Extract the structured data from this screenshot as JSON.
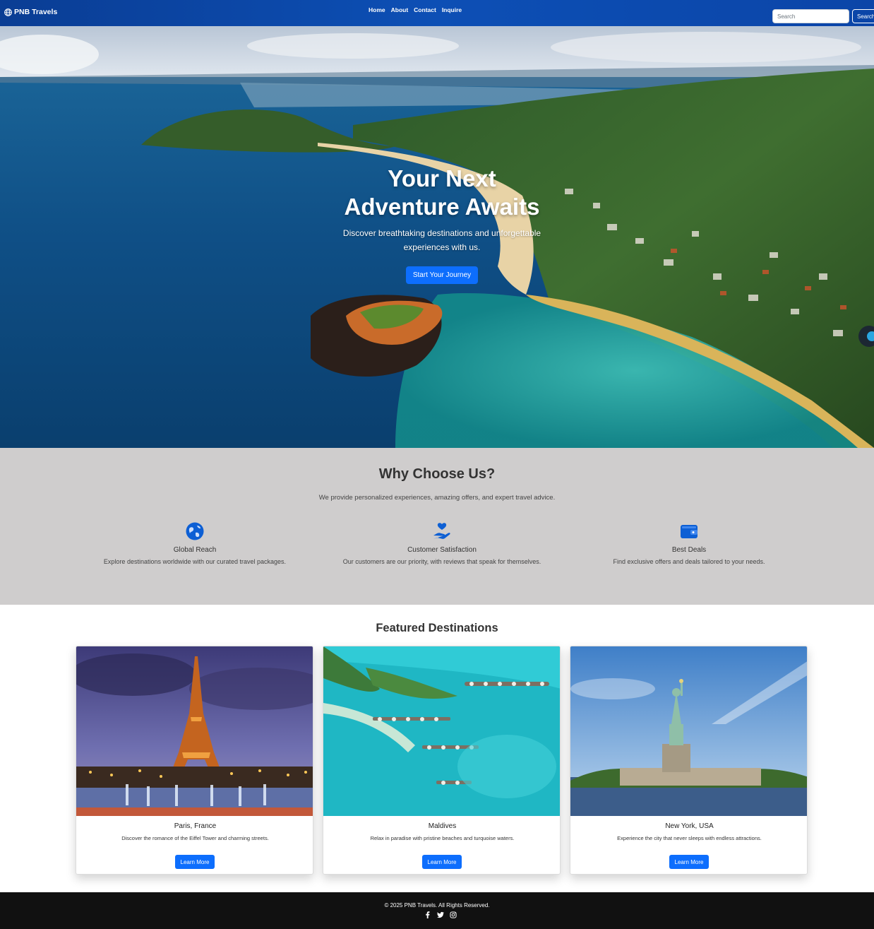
{
  "navbar": {
    "brand": "PNB Travels",
    "brand_icon": "globe-icon",
    "links": [
      "Home",
      "About",
      "Contact",
      "Inquire"
    ],
    "search_placeholder": "Search",
    "search_button": "Search"
  },
  "hero": {
    "title": "Your Next Adventure Awaits",
    "subtitle": "Discover breathtaking destinations and unforgettable experiences with us.",
    "cta": "Start Your Journey"
  },
  "why": {
    "title": "Why Choose Us?",
    "subtitle": "We provide personalized experiences, amazing offers, and expert travel advice.",
    "features": [
      {
        "icon": "globe-icon",
        "title": "Global Reach",
        "text": "Explore destinations worldwide with our curated travel packages."
      },
      {
        "icon": "hand-heart-icon",
        "title": "Customer Satisfaction",
        "text": "Our customers are our priority, with reviews that speak for themselves."
      },
      {
        "icon": "wallet-icon",
        "title": "Best Deals",
        "text": "Find exclusive offers and deals tailored to your needs."
      }
    ]
  },
  "featured": {
    "title": "Featured Destinations",
    "cards": [
      {
        "title": "Paris, France",
        "text": "Discover the romance of the Eiffel Tower and charming streets.",
        "button": "Learn More"
      },
      {
        "title": "Maldives",
        "text": "Relax in paradise with pristine beaches and turquoise waters.",
        "button": "Learn More"
      },
      {
        "title": "New York, USA",
        "text": "Experience the city that never sleeps with endless attractions.",
        "button": "Learn More"
      }
    ]
  },
  "footer": {
    "copyright": "© 2025 PNB Travels. All Rights Reserved.",
    "socials": [
      "facebook-icon",
      "twitter-icon",
      "instagram-icon"
    ]
  },
  "colors": {
    "primary": "#0d6efd",
    "nav": "#0d4fb5",
    "section_bg": "#cfcdcd",
    "footer": "#111111"
  }
}
